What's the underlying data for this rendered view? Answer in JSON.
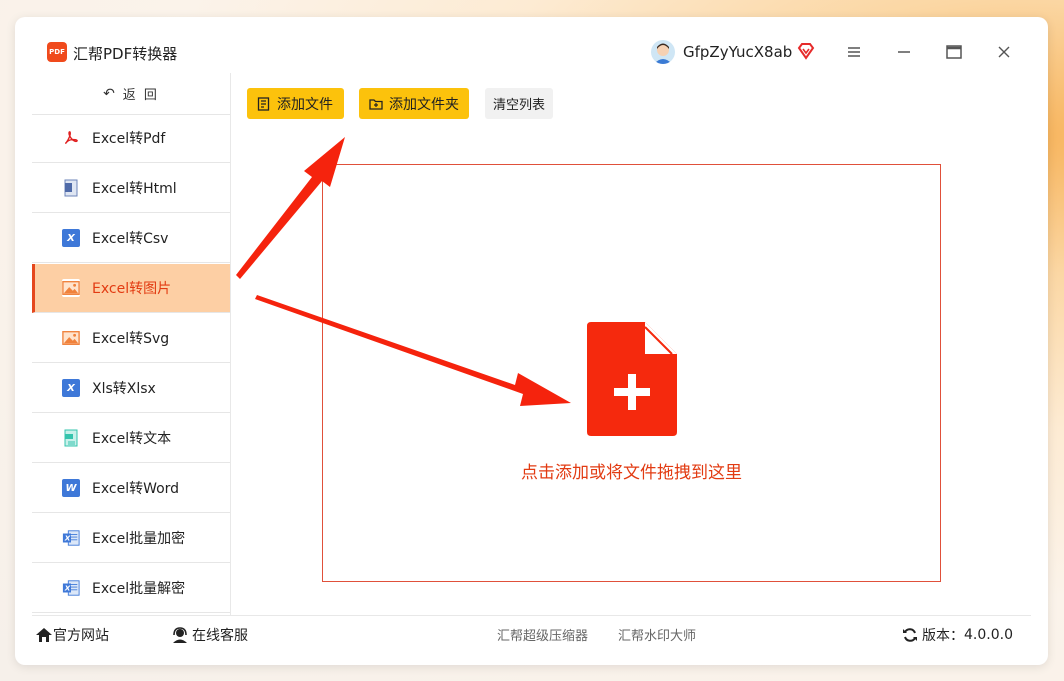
{
  "app": {
    "title": "汇帮PDF转换器",
    "logo_text": "PDF"
  },
  "user": {
    "name": "GfpZyYucX8ab"
  },
  "window_controls": [
    "menu-icon",
    "minimize-icon",
    "maximize-icon",
    "close-icon"
  ],
  "sidebar": {
    "back_label": "返 回",
    "items": [
      {
        "label": "Excel转Pdf",
        "icon": "pdf-icon",
        "active": false
      },
      {
        "label": "Excel转Html",
        "icon": "html-icon",
        "active": false
      },
      {
        "label": "Excel转Csv",
        "icon": "excel-icon",
        "active": false
      },
      {
        "label": "Excel转图片",
        "icon": "image-icon",
        "active": true
      },
      {
        "label": "Excel转Svg",
        "icon": "image-icon",
        "active": false
      },
      {
        "label": "Xls转Xlsx",
        "icon": "excel-icon",
        "active": false
      },
      {
        "label": "Excel转文本",
        "icon": "text-icon",
        "active": false
      },
      {
        "label": "Excel转Word",
        "icon": "word-icon",
        "active": false
      },
      {
        "label": "Excel批量加密",
        "icon": "excel-lock-icon",
        "active": false
      },
      {
        "label": "Excel批量解密",
        "icon": "excel-unlock-icon",
        "active": false
      }
    ]
  },
  "toolbar": {
    "add_file": "添加文件",
    "add_folder": "添加文件夹",
    "clear_list": "清空列表"
  },
  "dropzone": {
    "text": "点击添加或将文件拖拽到这里"
  },
  "footer": {
    "website": "官方网站",
    "support": "在线客服",
    "link1": "汇帮超级压缩器",
    "link2": "汇帮水印大师",
    "version_label": "版本：",
    "version": "4.0.0.0"
  },
  "colors": {
    "accent": "#e5471d",
    "button": "#fcc20c",
    "active_bg": "#fdcfa4"
  }
}
